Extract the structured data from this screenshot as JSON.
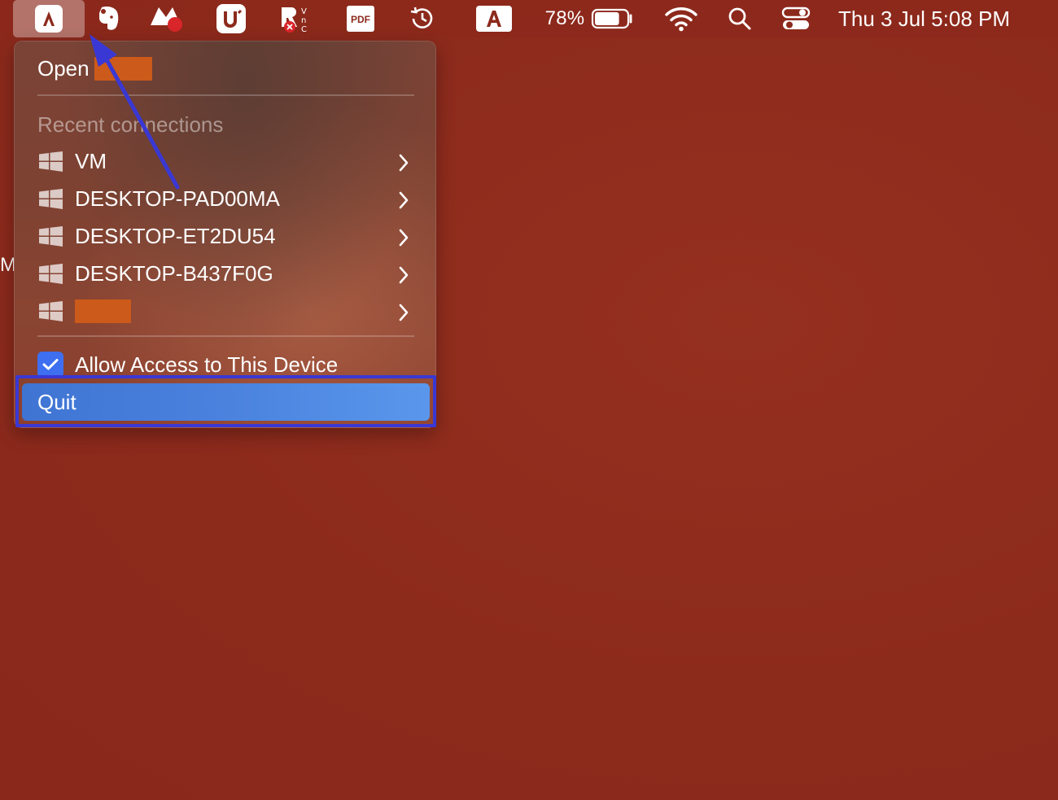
{
  "menubar": {
    "status_items": [
      {
        "icon": "app-a-icon",
        "active": true
      },
      {
        "icon": "evernote-elephant-icon"
      },
      {
        "icon": "record-icon"
      },
      {
        "icon": "u-app-icon"
      },
      {
        "icon": "vpn-disconnected-icon"
      },
      {
        "icon": "pdf-icon"
      },
      {
        "icon": "time-machine-icon"
      },
      {
        "icon": "input-source-a-icon"
      }
    ],
    "battery_percent": "78%",
    "battery_level": 0.78,
    "clock": "Thu 3 Jul  5:08 PM"
  },
  "desktop": {
    "stray_text": "M"
  },
  "menu": {
    "open_label": "Open",
    "recent_label": "Recent connections",
    "connections": [
      {
        "name": "VM"
      },
      {
        "name": "DESKTOP-PAD00MA"
      },
      {
        "name": "DESKTOP-ET2DU54"
      },
      {
        "name": "DESKTOP-B437F0G"
      },
      {
        "name": ""
      }
    ],
    "allow_access_label": "Allow Access to This Device",
    "allow_access_checked": true,
    "quit_label": "Quit"
  },
  "colors": {
    "desktop": "#8f2b1d",
    "redaction": "#cc5a1a",
    "quit_highlight": "#4a82de",
    "annotation": "#3a38d4"
  }
}
